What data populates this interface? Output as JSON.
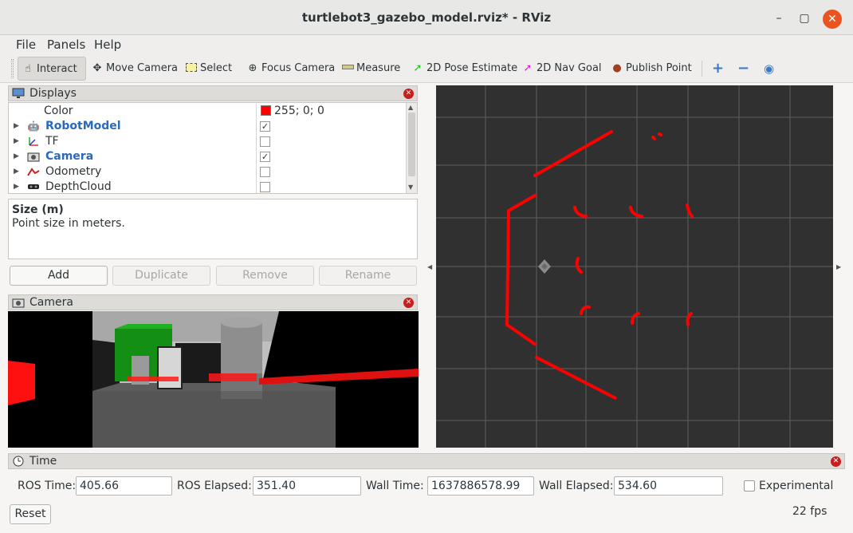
{
  "window": {
    "title": "turtlebot3_gazebo_model.rviz* - RViz",
    "minimize_glyph": "–",
    "maximize_glyph": "▢",
    "close_glyph": "✕"
  },
  "menu": [
    "File",
    "Panels",
    "Help"
  ],
  "toolbar": {
    "interact": "Interact",
    "move_camera": "Move Camera",
    "select": "Select",
    "focus_camera": "Focus Camera",
    "measure": "Measure",
    "pose_estimate": "2D Pose Estimate",
    "nav_goal": "2D Nav Goal",
    "publish_point": "Publish Point"
  },
  "displays": {
    "title": "Displays",
    "color_label": "Color",
    "color_value": "255; 0; 0",
    "items": [
      {
        "label": "RobotModel",
        "checked": true,
        "icon": "robot-icon"
      },
      {
        "label": "TF",
        "checked": false,
        "icon": "axes-icon"
      },
      {
        "label": "Camera",
        "checked": true,
        "icon": "camera-icon"
      },
      {
        "label": "Odometry",
        "checked": false,
        "icon": "odometry-icon"
      },
      {
        "label": "DepthCloud",
        "checked": false,
        "icon": "depthcloud-icon"
      }
    ],
    "check_glyph": "✓"
  },
  "description": {
    "title": "Size (m)",
    "text": "Point size in meters."
  },
  "buttons": {
    "add": "Add",
    "duplicate": "Duplicate",
    "remove": "Remove",
    "rename": "Rename"
  },
  "camera_panel": {
    "title": "Camera"
  },
  "time": {
    "title": "Time",
    "ros_time_label": "ROS Time:",
    "ros_time": "405.66",
    "ros_elapsed_label": "ROS Elapsed:",
    "ros_elapsed": "351.40",
    "wall_time_label": "Wall Time:",
    "wall_time": "1637886578.99",
    "wall_elapsed_label": "Wall Elapsed:",
    "wall_elapsed": "534.60",
    "experimental_label": "Experimental",
    "reset": "Reset",
    "fps": "22 fps"
  },
  "colors": {
    "accent": "#e95420",
    "laser": "#ff0000",
    "link_blue": "#2a6ab8"
  }
}
